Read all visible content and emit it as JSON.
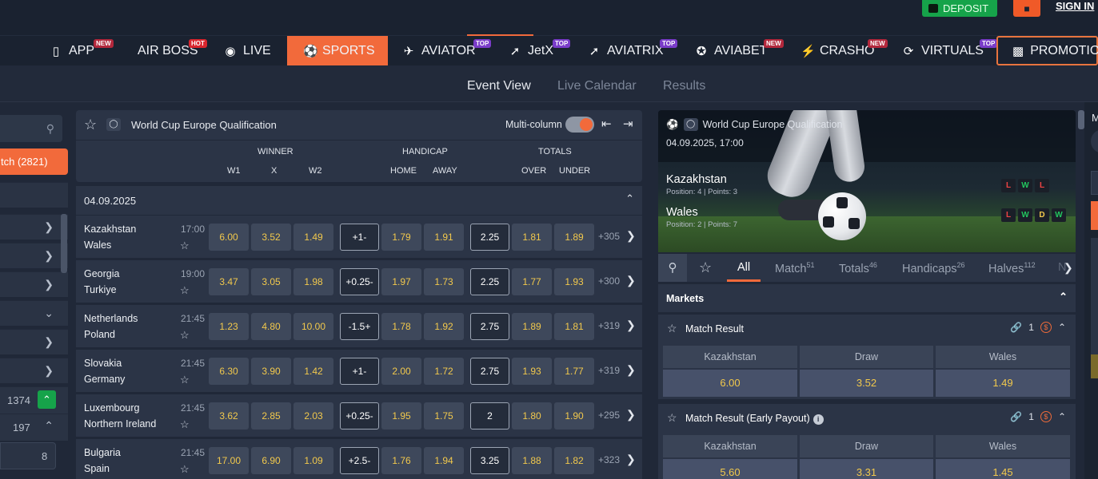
{
  "header": {
    "deposit": "DEPOSIT",
    "sign_in": "SIGN IN"
  },
  "nav": [
    {
      "label": "APP",
      "icon": "phone-icon",
      "badge": "NEW"
    },
    {
      "label": "AIR BOSS",
      "badge": "HOT"
    },
    {
      "label": "LIVE",
      "icon": "live-icon"
    },
    {
      "label": "SPORTS",
      "icon": "soccer-ball-icon",
      "active": true
    },
    {
      "label": "AVIATOR",
      "icon": "plane-icon",
      "badge": "TOP"
    },
    {
      "label": "JetX",
      "icon": "jet-icon",
      "badge": "TOP"
    },
    {
      "label": "AVIATRIX",
      "icon": "aviatrix-icon",
      "badge": "TOP"
    },
    {
      "label": "AVIABET",
      "icon": "aviabet-icon",
      "badge": "NEW"
    },
    {
      "label": "CRASHO",
      "icon": "lightning-icon",
      "badge": "NEW"
    },
    {
      "label": "VIRTUALS",
      "icon": "virtuals-icon",
      "badge": "TOP"
    },
    {
      "label": "PROMOTIO",
      "icon": "gift-icon"
    }
  ],
  "tabs": [
    "Event View",
    "Live Calendar",
    "Results"
  ],
  "sidebar": {
    "match_label": "tch (2821)",
    "count_a": "1374",
    "count_b": "197",
    "count_c": "8"
  },
  "event": {
    "title": "World Cup Europe Qualification",
    "multicolumn": "Multi-column",
    "groups": {
      "winner": "WINNER",
      "handicap": "HANDICAP",
      "totals": "TOTALS"
    },
    "subs": {
      "w1": "W1",
      "x": "X",
      "w2": "W2",
      "home": "HOME",
      "away": "AWAY",
      "over": "OVER",
      "under": "UNDER"
    },
    "date": "04.09.2025"
  },
  "matches": [
    {
      "home": "Kazakhstan",
      "away": "Wales",
      "time": "17:00",
      "w1": "6.00",
      "x": "3.52",
      "w2": "1.49",
      "hcap": "+1-",
      "hh": "1.79",
      "ha": "1.91",
      "total": "2.25",
      "over": "1.81",
      "under": "1.89",
      "more": "+305"
    },
    {
      "home": "Georgia",
      "away": "Turkiye",
      "time": "19:00",
      "w1": "3.47",
      "x": "3.05",
      "w2": "1.98",
      "hcap": "+0.25-",
      "hh": "1.97",
      "ha": "1.73",
      "total": "2.25",
      "over": "1.77",
      "under": "1.93",
      "more": "+300"
    },
    {
      "home": "Netherlands",
      "away": "Poland",
      "time": "21:45",
      "w1": "1.23",
      "x": "4.80",
      "w2": "10.00",
      "hcap": "-1.5+",
      "hh": "1.78",
      "ha": "1.92",
      "total": "2.75",
      "over": "1.89",
      "under": "1.81",
      "more": "+319"
    },
    {
      "home": "Slovakia",
      "away": "Germany",
      "time": "21:45",
      "w1": "6.30",
      "x": "3.90",
      "w2": "1.42",
      "hcap": "+1-",
      "hh": "2.00",
      "ha": "1.72",
      "total": "2.75",
      "over": "1.93",
      "under": "1.77",
      "more": "+319"
    },
    {
      "home": "Luxembourg",
      "away": "Northern Ireland",
      "time": "21:45",
      "w1": "3.62",
      "x": "2.85",
      "w2": "2.03",
      "hcap": "+0.25-",
      "hh": "1.95",
      "ha": "1.75",
      "total": "2",
      "over": "1.80",
      "under": "1.90",
      "more": "+295"
    },
    {
      "home": "Bulgaria",
      "away": "Spain",
      "time": "21:45",
      "w1": "17.00",
      "x": "6.90",
      "w2": "1.09",
      "hcap": "+2.5-",
      "hh": "1.76",
      "ha": "1.94",
      "total": "3.25",
      "over": "1.88",
      "under": "1.82",
      "more": "+323"
    }
  ],
  "detail": {
    "league": "World Cup Europe Qualification",
    "datetime": "04.09.2025, 17:00",
    "home": "Kazakhstan",
    "home_pos": "Position: 4 | Points: 3",
    "away": "Wales",
    "away_pos": "Position: 2 | Points: 7",
    "home_form": [
      "L",
      "W",
      "L"
    ],
    "away_form": [
      "L",
      "W",
      "D",
      "W"
    ],
    "tabs": [
      {
        "label": "All",
        "count": ""
      },
      {
        "label": "Match",
        "count": "51"
      },
      {
        "label": "Totals",
        "count": "46"
      },
      {
        "label": "Handicaps",
        "count": "26"
      },
      {
        "label": "Halves",
        "count": "112"
      },
      {
        "label": "N",
        "count": ""
      }
    ],
    "markets_label": "Markets",
    "markets": [
      {
        "title": "Match Result",
        "links": "1",
        "cols": [
          "Kazakhstan",
          "Draw",
          "Wales"
        ],
        "odds": [
          "6.00",
          "3.52",
          "1.49"
        ]
      },
      {
        "title": "Match Result (Early Payout)",
        "links": "1",
        "cols": [
          "Kazakhstan",
          "Draw",
          "Wales"
        ],
        "odds": [
          "5.60",
          "3.31",
          "1.45"
        ]
      }
    ],
    "side_letter": "M"
  },
  "colors": {
    "accent": "#f26a3b",
    "odds": "#f2c94c",
    "deposit": "#16a34a"
  }
}
